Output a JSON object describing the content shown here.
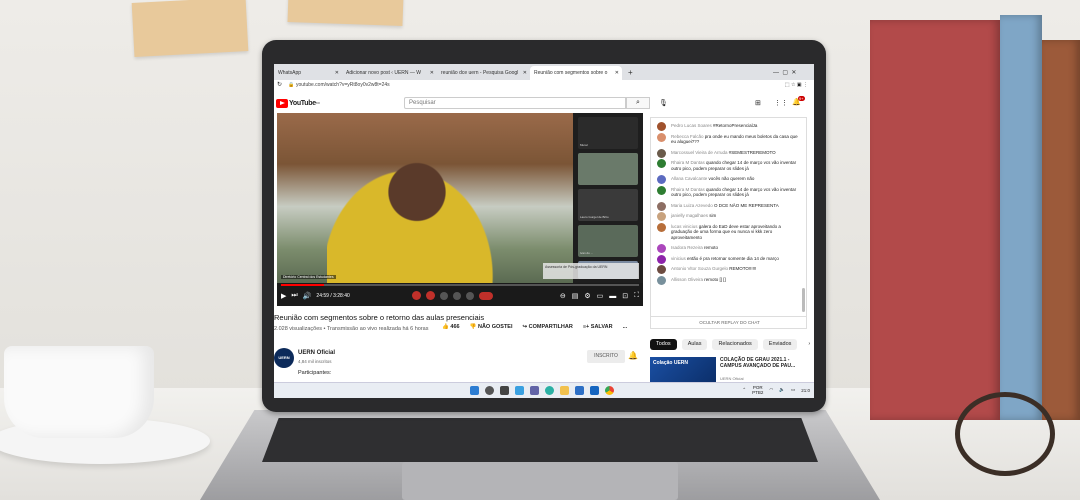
{
  "browser": {
    "tabs": [
      {
        "label": "WhatsApp",
        "active": false
      },
      {
        "label": "Adicionar novo post ‹ UERN — W",
        "active": false
      },
      {
        "label": "reunião dce uern - Pesquisa Googl",
        "active": false
      },
      {
        "label": "Reunião com segmentos sobre o",
        "active": true
      }
    ],
    "new_tab": "+",
    "url": "youtube.com/watch?v=yRt8oy0v2w8t=24s"
  },
  "youtube": {
    "logo_text": "YouTube",
    "logo_region": "BR",
    "search_placeholder": "Pesquisar",
    "notification_count": "9+"
  },
  "video": {
    "current_time": "24:59 / 3:28:40",
    "progress_fraction": 0.12,
    "presenter_caption": "Diretório Central dos Estudantes",
    "participant_tiles": [
      {
        "label": "Mural"
      },
      {
        "label": ""
      },
      {
        "label": "Lauro Gurgel de Brito"
      },
      {
        "label": "Ivan do ..."
      },
      {
        "label": ""
      }
    ],
    "overlay_caption": "Assessoria de Pós-graduação da UERN"
  },
  "details": {
    "title": "Reunião com segmentos sobre o retorno das aulas presenciais",
    "meta": "2.028 visualizações • Transmissão ao vivo realizada há 6 horas",
    "likes": "466",
    "dislike_label": "NÃO GOSTEI",
    "share_label": "COMPARTILHAR",
    "save_label": "SALVAR",
    "more_label": "...",
    "channel_name": "UERN Oficial",
    "channel_subs": "4,84 mil inscritos",
    "channel_avatar_text": "UERN",
    "subscribe_label": "INSCRITO",
    "description_start": "Participantes:"
  },
  "chat": {
    "messages": [
      {
        "author": "Pedro Lucas Soares",
        "text": "#RetornoPresencialJa",
        "color": "#a0522d"
      },
      {
        "author": "Rebecca Falcão",
        "text": "pra onde eu mando meus boletos da casa que eu aluguei???",
        "color": "#d98f6c"
      },
      {
        "author": "Marcossuel Vieira de Arruda",
        "text": "#SEMESTREREMOTO",
        "color": "#6b5b4b"
      },
      {
        "author": "Rhaira M Dantas",
        "text": "quando chegar 14 de março vcs vão inventar outro pico, podem preparar os slides já",
        "color": "#2e7d32"
      },
      {
        "author": "Allana Cavalcante",
        "text": "vocês não querem não",
        "color": "#5c6bc0"
      },
      {
        "author": "Rhaira M Dantas",
        "text": "quando chegar 14 de março vcs vão inventar outro pico, podem preparar os slides já",
        "color": "#2e7d32"
      },
      {
        "author": "Maria Luiza Azevedo",
        "text": "O DCE NÃO ME REPRESENTA",
        "color": "#8d6e63"
      },
      {
        "author": "janielly magalhaes",
        "text": "sim",
        "color": "#c8a27e"
      },
      {
        "author": "lucas vinicius",
        "text": "galera do EaD deve estar aproveitando a graduação de uma forma que eu nunca vi kkk zero aproveitamento",
        "color": "#b76e3a"
      },
      {
        "author": "Isadora Rezeira",
        "text": "remoto",
        "color": "#ab47bc"
      },
      {
        "author": "vinicius",
        "text": "então é pra retornar somente dia 14 de março",
        "color": "#8e24aa"
      },
      {
        "author": "Antonio Vitor Souza Gurgelo",
        "text": "REMOTO!!!!!!",
        "color": "#6d4c41"
      },
      {
        "author": "Allisson Oliveira",
        "text": "remoto [] []",
        "color": "#78909c"
      }
    ],
    "hide_replay": "OCULTAR REPLAY DO CHAT"
  },
  "recommendations": {
    "chips": [
      "Todos",
      "Aulas",
      "Relacionados",
      "Enviados",
      "›"
    ],
    "first": {
      "title": "COLAÇÃO DE GRAU 2021.1 - CAMPUS AVANÇADO DE PAU...",
      "channel": "UERN Oficial",
      "thumb_text": "Colação UERN"
    }
  },
  "taskbar": {
    "lang": "POR",
    "layout": "PTB2",
    "time": "21:0"
  }
}
